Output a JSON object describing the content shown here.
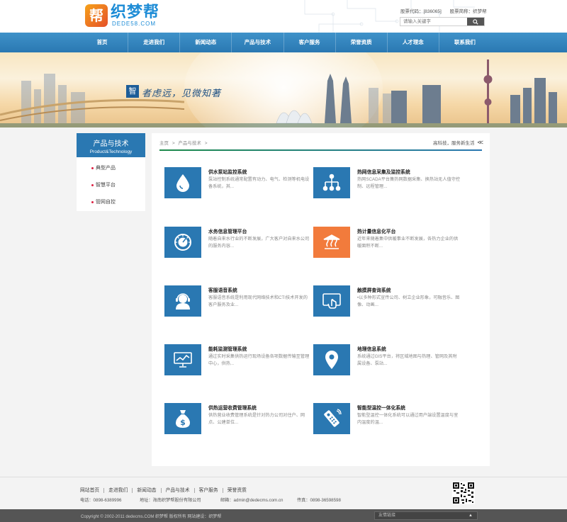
{
  "header": {
    "logo_mark": "帮",
    "logo_title": "织梦帮",
    "logo_sub": "DEDE58.COM",
    "stock_code": "股票代码：[836065]",
    "stock_name": "股票简称：织梦帮",
    "search_placeholder": "请输入关键字"
  },
  "nav": [
    "首页",
    "走进我们",
    "新闻动态",
    "产品与技术",
    "客户服务",
    "荣誉资质",
    "人才理念",
    "联系我们"
  ],
  "banner": {
    "mark": "智",
    "slogan": "者虑远，见微知著"
  },
  "sidebar": {
    "title": "产品与技术",
    "subtitle": "Product&Technology",
    "items": [
      "典型产品",
      "智慧平台",
      "管网自控"
    ]
  },
  "main": {
    "crumb": [
      "主页",
      "产品与技术"
    ],
    "tagline": "高科技，服务新生活",
    "products": [
      {
        "title": "供水泵站监控系统",
        "desc": "泵站控制系统通常配置有动力、电气、检测等机电设备系统，其...",
        "icon": "water-drop-icon",
        "color": "#2a78b2"
      },
      {
        "title": "热网信息采集及监控系统",
        "desc": "热网SCADA平台集热网数据采集、换热站无人值守控制、远程管理...",
        "icon": "network-tree-icon",
        "color": "#2a78b2"
      },
      {
        "title": "水务信息管理平台",
        "desc": "随着自来水行业的不断发展，广大客户对自来水公司的服务内容...",
        "icon": "gauge-icon",
        "color": "#2a78b2"
      },
      {
        "title": "热计量信息化平台",
        "desc": "近年来随着集中供暖事业不断发展，各热力企业的供暖面积不断...",
        "icon": "heating-icon",
        "color": "#f27b3c"
      },
      {
        "title": "客服语音系统",
        "desc": "客服语音系统是利用现代网络技术和CTI技术开发的客户服务及业...",
        "icon": "headset-icon",
        "color": "#2a78b2"
      },
      {
        "title": "触摸屏查询系统",
        "desc": "•以多种形式宣传公司、树立企业形象，可融音乐、图像、动画...",
        "icon": "touchscreen-icon",
        "color": "#2a78b2"
      },
      {
        "title": "能耗监测管理系统",
        "desc": "通过实时采集供热运行现场设备各项数据传输至管理中心，供热...",
        "icon": "monitor-chart-icon",
        "color": "#2a78b2"
      },
      {
        "title": "地理信息系统",
        "desc": "系统通过GIS平台，将区域地图与热理、管网及其附属设备、泵站...",
        "icon": "map-pin-icon",
        "color": "#2a78b2"
      },
      {
        "title": "供热运营收费管理系统",
        "desc": "供热营业收费管理系统是针对热力公司对住户、网点、公建单位...",
        "icon": "money-bag-icon",
        "color": "#2a78b2"
      },
      {
        "title": "智能型温控一体化系统",
        "desc": "智能型温控一体化系统可以通过用户端设置温度与室内温度的温...",
        "icon": "remote-control-icon",
        "color": "#2a78b2"
      }
    ]
  },
  "footer": {
    "links": [
      "网站首页",
      "走进我们",
      "新闻动态",
      "产品与技术",
      "客户服务",
      "荣誉资质"
    ],
    "phone": "电话：0898-6389996",
    "address": "地址：海南织梦帮股份有限公司",
    "email": "邮箱：admin@dedecms.com.cn",
    "fax": "传真：0898-36598598",
    "copyright": "Copyright © 2002-2011 dedecms.COM 织梦帮 版权所有 网站建设：织梦帮",
    "friend_links": "友情链接"
  }
}
